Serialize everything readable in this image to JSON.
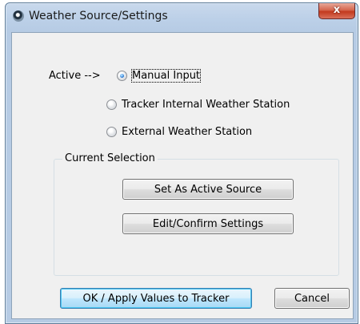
{
  "window": {
    "title": "Weather Source/Settings",
    "close_label": "x"
  },
  "active_indicator": "Active -->",
  "sources": [
    {
      "label": "Manual Input",
      "checked": true
    },
    {
      "label": "Tracker Internal Weather Station",
      "checked": false
    },
    {
      "label": "External Weather Station",
      "checked": false
    }
  ],
  "current_selection": {
    "label": "Current Selection",
    "set_active_label": "Set As Active Source",
    "edit_label": "Edit/Confirm Settings"
  },
  "footer": {
    "ok_label": "OK / Apply Values to Tracker",
    "cancel_label": "Cancel"
  }
}
